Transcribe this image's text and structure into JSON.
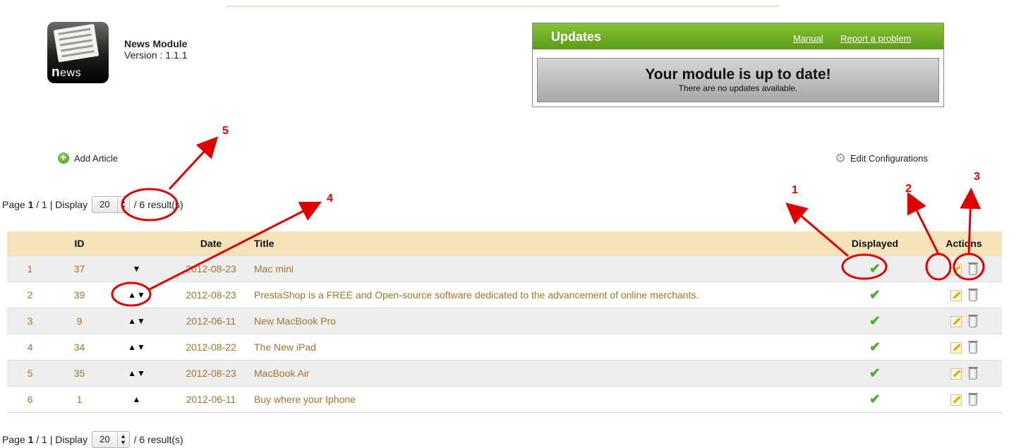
{
  "module": {
    "name": "News Module",
    "version": "Version : 1.1.1",
    "logo_text": "ews",
    "logo_letter": "n"
  },
  "updates": {
    "title": "Updates",
    "manual_link": "Manual",
    "report_link": "Report a problem",
    "status_main": "Your module is up to date!",
    "status_sub": "There are no updates available."
  },
  "actions": {
    "add_article": "Add Article",
    "edit_config": "Edit Configurations"
  },
  "pagination": {
    "prefix": "Page",
    "current": "1",
    "total_sep": "/ 1 | Display",
    "per_page": "20",
    "results": "/ 6 result(s)"
  },
  "table": {
    "headers": {
      "id": "ID",
      "date": "Date",
      "title": "Title",
      "displayed": "Displayed",
      "actions": "Actions"
    },
    "rows": [
      {
        "num": "1",
        "id": "37",
        "order": "▼",
        "date": "2012-08-23",
        "title": "Mac mini",
        "displayed": "✔"
      },
      {
        "num": "2",
        "id": "39",
        "order": "▲▼",
        "date": "2012-08-23",
        "title": "PrestaShop is a FREE and Open-source software dedicated to the advancement of online merchants.",
        "displayed": "✔"
      },
      {
        "num": "3",
        "id": "9",
        "order": "▲▼",
        "date": "2012-06-11",
        "title": "New MacBook Pro",
        "displayed": "✔"
      },
      {
        "num": "4",
        "id": "34",
        "order": "▲▼",
        "date": "2012-08-22",
        "title": "The New iPad",
        "displayed": "✔"
      },
      {
        "num": "5",
        "id": "35",
        "order": "▲▼",
        "date": "2012-08-23",
        "title": "MacBook Air",
        "displayed": "✔"
      },
      {
        "num": "6",
        "id": "1",
        "order": "▲",
        "date": "2012-06-11",
        "title": "Buy where your Iphone",
        "displayed": "✔"
      }
    ]
  },
  "annotations": {
    "color": "#e00000",
    "labels": [
      "1",
      "2",
      "3",
      "4",
      "5"
    ]
  },
  "icons": {
    "add": "plus-circle-icon",
    "config": "gear-icon",
    "displayed": "checkmark-icon",
    "edit": "pencil-icon",
    "delete": "trash-icon"
  }
}
